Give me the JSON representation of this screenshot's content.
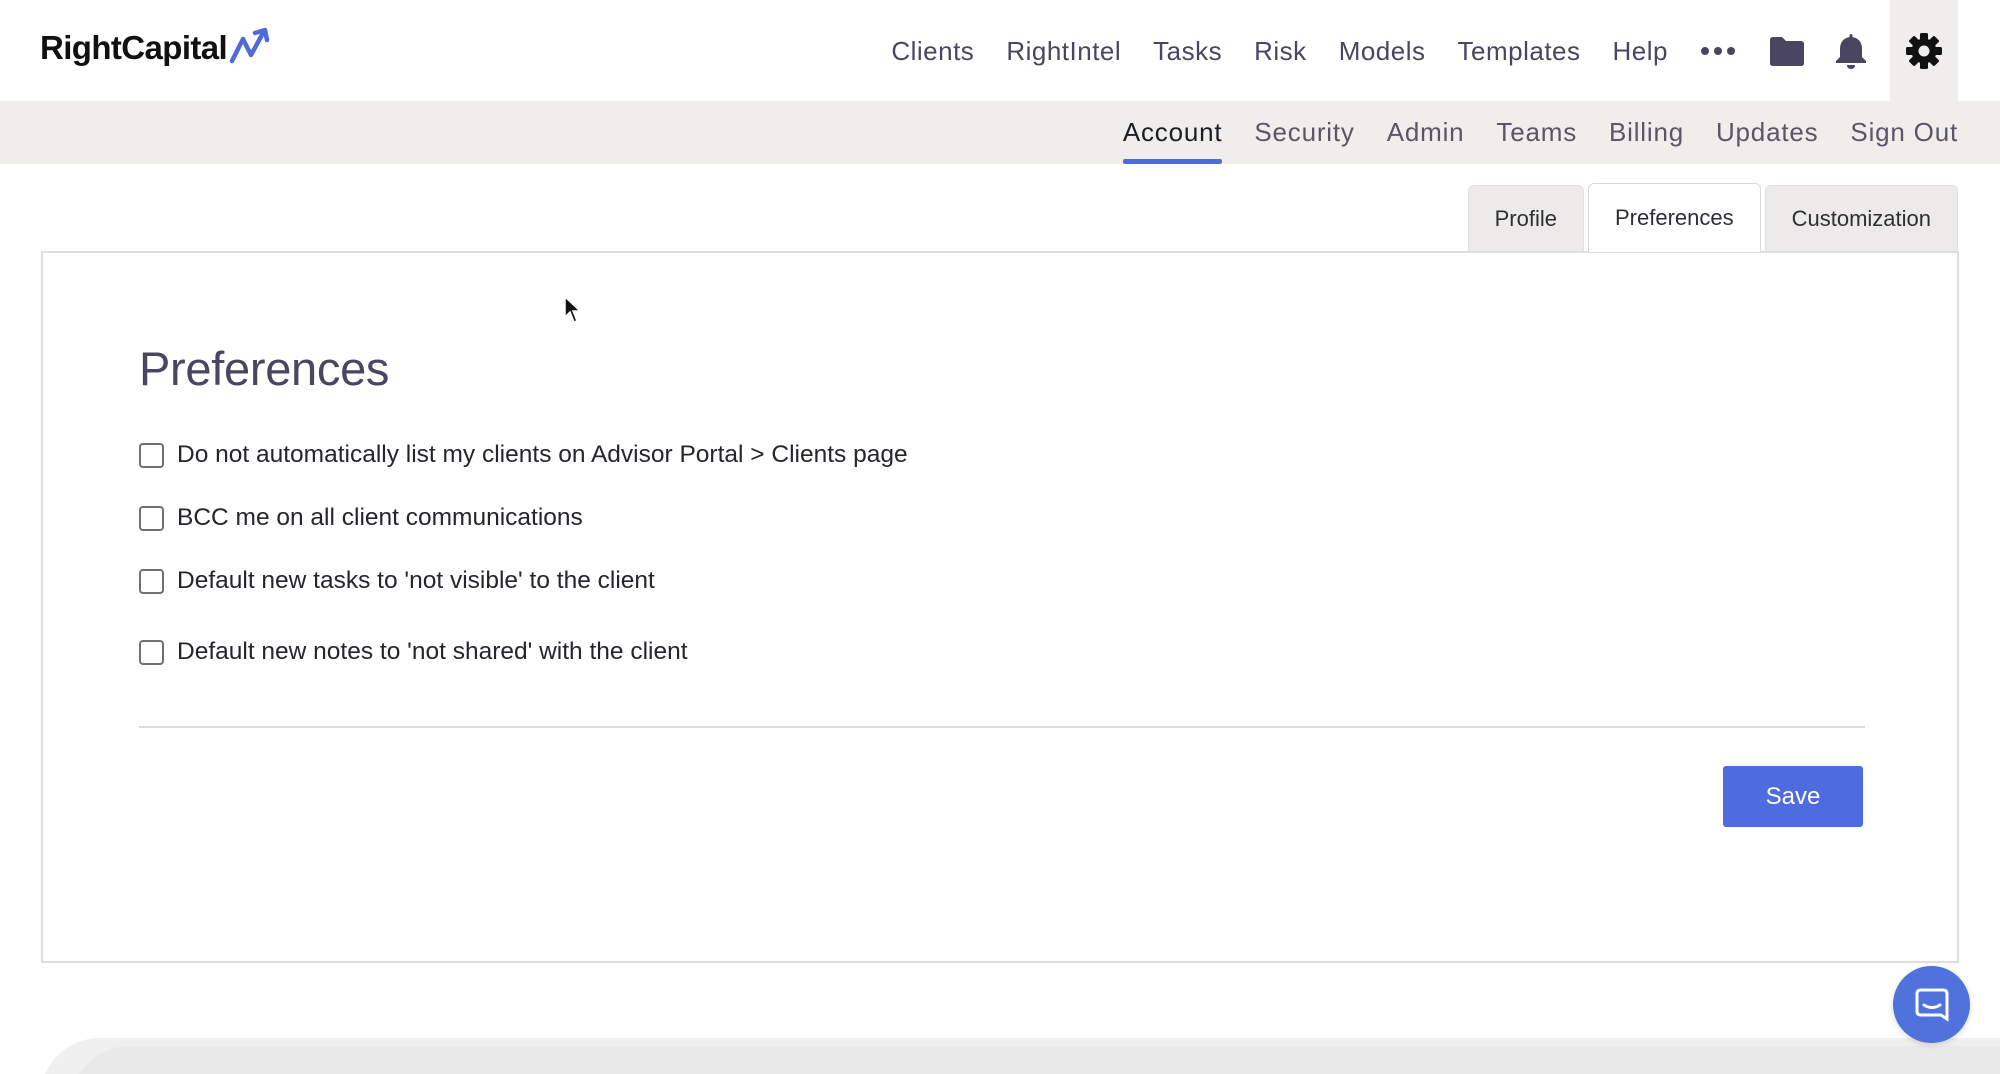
{
  "app": {
    "logo_text": "RightCapital"
  },
  "main_nav": {
    "items": [
      {
        "label": "Clients"
      },
      {
        "label": "RightIntel"
      },
      {
        "label": "Tasks"
      },
      {
        "label": "Risk"
      },
      {
        "label": "Models"
      },
      {
        "label": "Templates"
      },
      {
        "label": "Help"
      }
    ],
    "icons": [
      "more-icon",
      "folder-icon",
      "bell-icon",
      "gear-icon"
    ]
  },
  "sub_nav": {
    "items": [
      {
        "label": "Account",
        "active": true
      },
      {
        "label": "Security"
      },
      {
        "label": "Admin"
      },
      {
        "label": "Teams"
      },
      {
        "label": "Billing"
      },
      {
        "label": "Updates"
      },
      {
        "label": "Sign Out"
      }
    ]
  },
  "tabs": {
    "items": [
      {
        "label": "Profile"
      },
      {
        "label": "Preferences",
        "active": true
      },
      {
        "label": "Customization"
      }
    ]
  },
  "card": {
    "title": "Preferences",
    "preferences": [
      {
        "label": "Do not automatically list my clients on Advisor Portal > Clients page",
        "checked": false
      },
      {
        "label": "BCC me on all client communications",
        "checked": false
      },
      {
        "label": "Default new tasks to 'not visible' to the client",
        "checked": false
      },
      {
        "label": "Default new notes to 'not shared' with the client",
        "checked": false
      }
    ],
    "save_label": "Save"
  },
  "colors": {
    "accent": "#4f6bd8",
    "save_button": "#4f6be0",
    "chat_button": "#4f72dd",
    "subbar_bg": "#efeeeb",
    "nav_text": "#4a4560"
  }
}
